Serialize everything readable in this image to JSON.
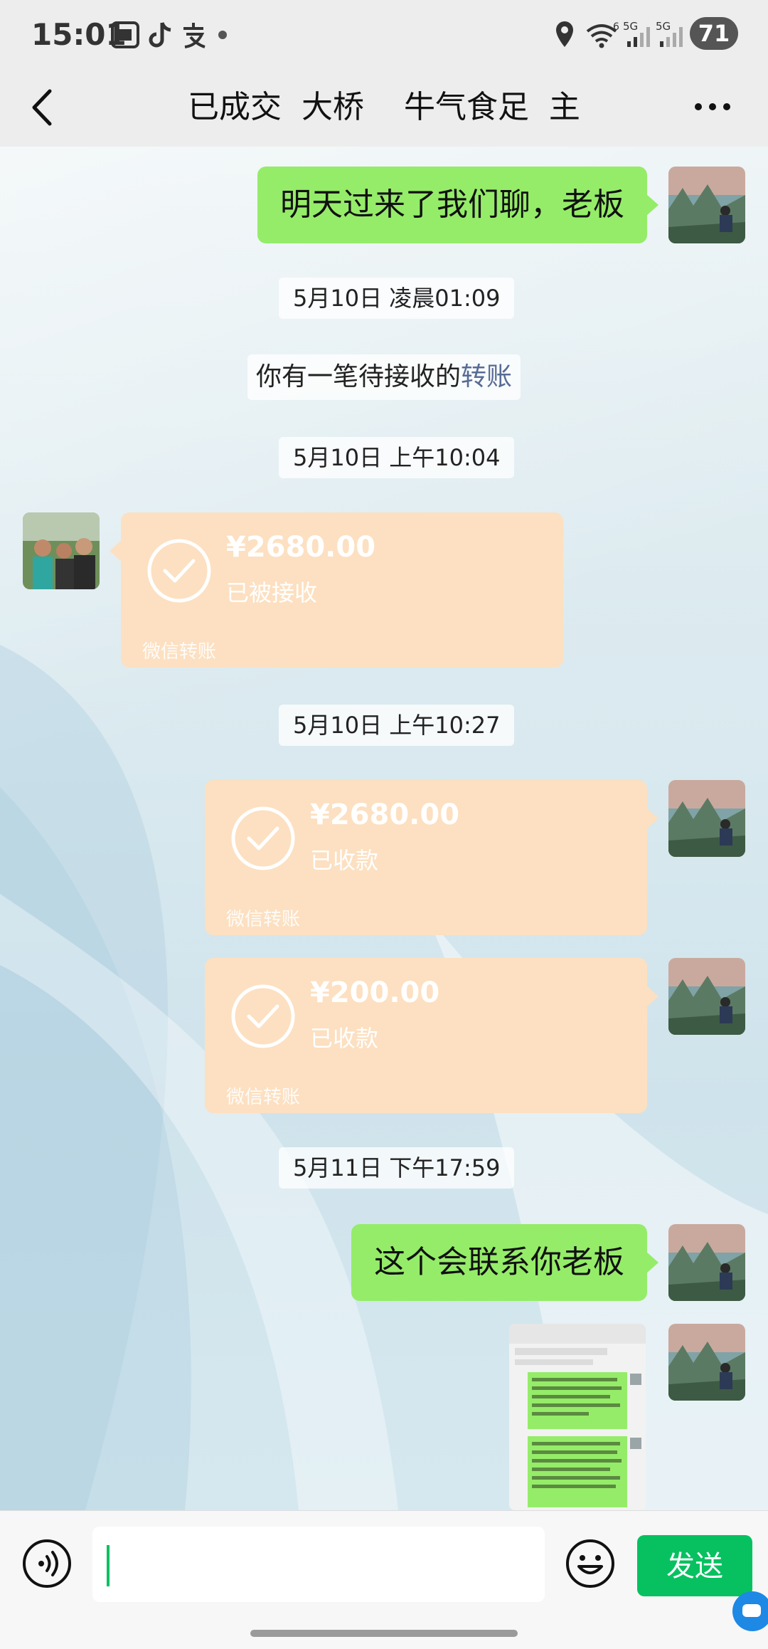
{
  "status_bar": {
    "time": "15:01",
    "battery": "71",
    "icons": [
      "screenshot-icon",
      "tiktok-icon",
      "alipay-icon",
      "dot-icon",
      "location-icon",
      "wifi-icon",
      "signal-5g-icon",
      "signal-5g-icon"
    ],
    "wifi_label": "6",
    "signal_1_label": "5G",
    "signal_2_label": "5G"
  },
  "nav": {
    "title": "已成交  大桥    牛气食足  主",
    "back_icon": "chevron-left-icon",
    "more_icon": "more-dots-icon"
  },
  "chat": {
    "msg1": {
      "text": "明天过来了我们聊，老板",
      "side": "right"
    },
    "stamp1": "5月10日 凌晨01:09",
    "sys1": {
      "text": "你有一笔待接收的",
      "link": "转账"
    },
    "stamp2": "5月10日 上午10:04",
    "transfer1": {
      "amount": "¥2680.00",
      "status": "已被接收",
      "brand": "微信转账",
      "side": "left"
    },
    "stamp3": "5月10日 上午10:27",
    "transfer2": {
      "amount": "¥2680.00",
      "status": "已收款",
      "brand": "微信转账",
      "side": "right"
    },
    "transfer3": {
      "amount": "¥200.00",
      "status": "已收款",
      "brand": "微信转账",
      "side": "right"
    },
    "stamp4": "5月11日 下午17:59",
    "msg2": {
      "text": "这个会联系你老板",
      "side": "right"
    },
    "image_msg": {
      "side": "right"
    }
  },
  "input_bar": {
    "value": "",
    "send_label": "发送",
    "voice_icon": "voice-icon",
    "emoji_icon": "emoji-icon"
  },
  "colors": {
    "self_bubble": "#95ec69",
    "transfer_bubble": "#fce0c1",
    "send_button": "#07c160",
    "link": "#576b95"
  }
}
